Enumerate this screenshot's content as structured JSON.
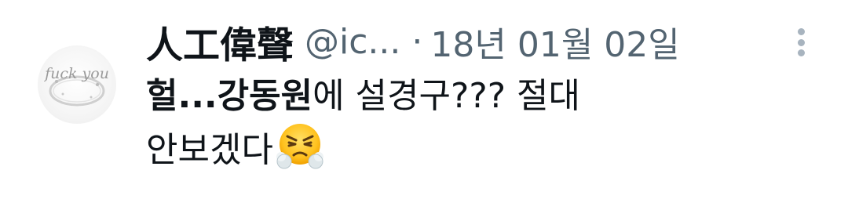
{
  "tweet": {
    "display_name": "人工偉聲",
    "handle": "@ic...",
    "separator": "·",
    "timestamp": "18년 01월 02일",
    "body": {
      "line1_prefix": "헐...",
      "line1_bold": "강동원",
      "line1_suffix": "에 설경구??? 절대",
      "line2_text": "안보겠다"
    },
    "emoji": "triumph-face-emoji",
    "avatar_text": "fuck you",
    "more_icon": "more-vertical-icon"
  }
}
